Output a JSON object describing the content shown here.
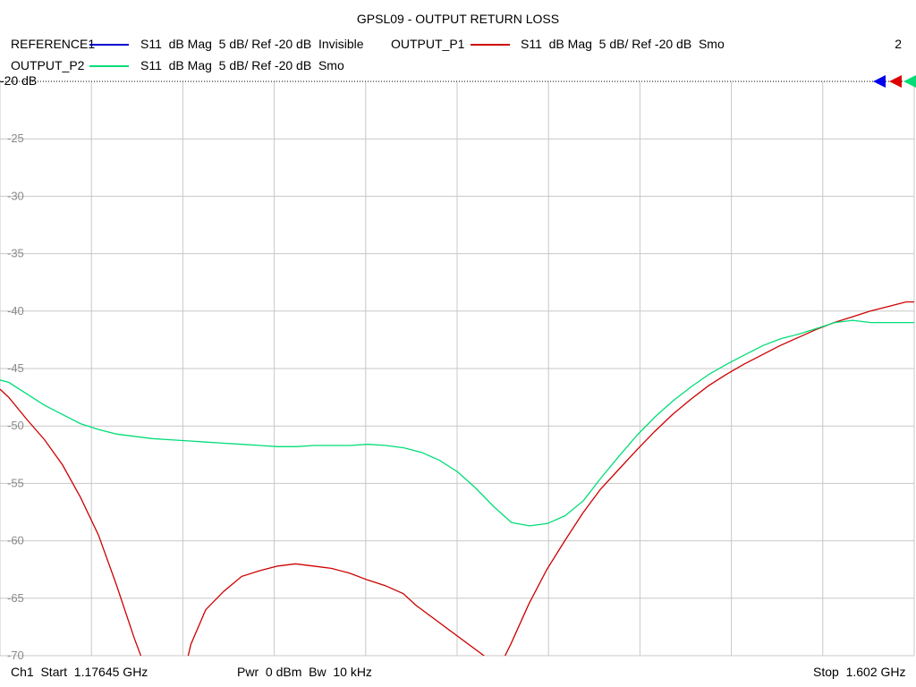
{
  "chart_data": {
    "type": "line",
    "title": "GPSL09 - OUTPUT RETURN LOSS",
    "ylim": [
      -70,
      -20
    ],
    "y_ticks": [
      "-20 dB",
      "-25",
      "-30",
      "-35",
      "-40",
      "-45",
      "-50",
      "-55",
      "-60",
      "-65",
      "-70"
    ],
    "y_tick_values": [
      -20,
      -25,
      -30,
      -35,
      -40,
      -45,
      -50,
      -55,
      -60,
      -65,
      -70
    ],
    "xlim": [
      1.17645,
      1.602
    ],
    "x_unit": "GHz",
    "grid": true,
    "series": [
      {
        "name": "REFERENCE1",
        "desc": "S11  dB Mag  5 dB/ Ref -20 dB  Invisible",
        "color": "#0000cc",
        "visible": false,
        "x": [],
        "y": []
      },
      {
        "name": "OUTPUT_P1",
        "desc": "S11  dB Mag  5 dB/ Ref -20 dB  Smo",
        "color": "#cc0000",
        "visible": true,
        "x": [
          1.17645,
          1.1805,
          1.1888,
          1.1972,
          1.2056,
          1.2139,
          1.2223,
          1.2306,
          1.239,
          1.244,
          1.2628,
          1.2653,
          1.2722,
          1.2806,
          1.2889,
          1.2973,
          1.3057,
          1.314,
          1.3224,
          1.3307,
          1.3391,
          1.3475,
          1.3558,
          1.3642,
          1.37,
          1.4089,
          1.4142,
          1.4226,
          1.431,
          1.4393,
          1.4477,
          1.456,
          1.4644,
          1.4728,
          1.4811,
          1.4895,
          1.4978,
          1.5062,
          1.5146,
          1.5229,
          1.5313,
          1.5396,
          1.548,
          1.5564,
          1.5647,
          1.5731,
          1.5815,
          1.5898,
          1.5982,
          1.602
        ],
        "y": [
          -46.8,
          -47.5,
          -49.4,
          -51.2,
          -53.4,
          -56.2,
          -59.5,
          -63.8,
          -68.5,
          -71.0,
          -71.0,
          -69.0,
          -66.0,
          -64.4,
          -63.1,
          -62.6,
          -62.2,
          -62.0,
          -62.2,
          -62.4,
          -62.8,
          -63.4,
          -63.9,
          -64.6,
          -65.6,
          -71.0,
          -69.0,
          -65.5,
          -62.5,
          -60.0,
          -57.6,
          -55.5,
          -53.8,
          -52.1,
          -50.5,
          -49.0,
          -47.7,
          -46.5,
          -45.5,
          -44.6,
          -43.8,
          -43.0,
          -42.3,
          -41.6,
          -41.0,
          -40.5,
          -40.0,
          -39.6,
          -39.2,
          -39.2
        ]
      },
      {
        "name": "OUTPUT_P2",
        "desc": "S11  dB Mag  5 dB/ Ref -20 dB  Smo",
        "color": "#00dd77",
        "visible": true,
        "x": [
          1.17645,
          1.1805,
          1.1888,
          1.1972,
          1.2056,
          1.2139,
          1.2223,
          1.2306,
          1.239,
          1.2473,
          1.2557,
          1.264,
          1.2724,
          1.2808,
          1.2891,
          1.2975,
          1.3059,
          1.3142,
          1.3226,
          1.3309,
          1.3393,
          1.3477,
          1.356,
          1.3644,
          1.3727,
          1.3811,
          1.3895,
          1.3978,
          1.4062,
          1.4145,
          1.4229,
          1.4312,
          1.4396,
          1.448,
          1.4563,
          1.4647,
          1.473,
          1.4814,
          1.4898,
          1.4981,
          1.5065,
          1.5149,
          1.5232,
          1.5316,
          1.5399,
          1.5483,
          1.5567,
          1.565,
          1.5734,
          1.5818,
          1.5901,
          1.5985,
          1.602
        ],
        "y": [
          -46.0,
          -46.2,
          -47.2,
          -48.2,
          -49.0,
          -49.8,
          -50.3,
          -50.7,
          -50.9,
          -51.1,
          -51.2,
          -51.3,
          -51.4,
          -51.5,
          -51.6,
          -51.7,
          -51.8,
          -51.8,
          -51.7,
          -51.7,
          -51.7,
          -51.6,
          -51.7,
          -51.9,
          -52.3,
          -53.0,
          -54.0,
          -55.4,
          -57.0,
          -58.4,
          -58.7,
          -58.5,
          -57.8,
          -56.5,
          -54.5,
          -52.6,
          -50.8,
          -49.2,
          -47.8,
          -46.6,
          -45.5,
          -44.6,
          -43.8,
          -43.0,
          -42.4,
          -42.0,
          -41.5,
          -41.0,
          -40.8,
          -41.0,
          -41.0,
          -41.0,
          -41.0
        ]
      }
    ]
  },
  "legend_count": "2",
  "footer": {
    "channel": "Ch1  Start  1.17645 GHz",
    "power": "Pwr  0 dBm  Bw  10 kHz",
    "stop": "Stop  1.602 GHz"
  }
}
